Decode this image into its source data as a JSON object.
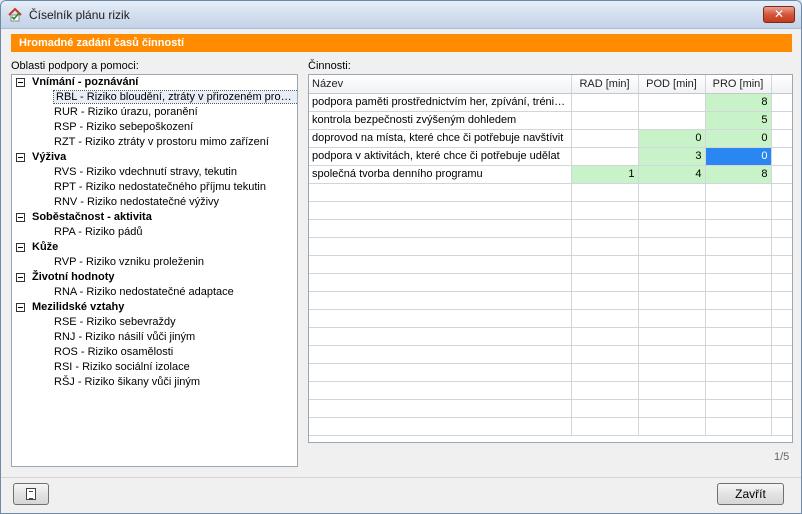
{
  "window": {
    "title": "Číselník plánu rizik",
    "close_glyph": "✕"
  },
  "banner": {
    "text": "Hromadné zadání časů činností"
  },
  "left_panel": {
    "label": "Oblasti podpory a pomoci:",
    "groups": [
      {
        "title": "Vnímání - poznávání",
        "items": [
          "RBL - Riziko bloudění, ztráty v přirozeném prostř...",
          "RUR - Riziko úrazu, poranění",
          "RSP - Riziko sebepoškození",
          "RZT - Riziko ztráty v prostoru mimo zařízení"
        ]
      },
      {
        "title": "Výživa",
        "items": [
          "RVS - Riziko vdechnutí stravy, tekutin",
          "RPT - Riziko nedostatečného příjmu tekutin",
          "RNV - Riziko nedostatečné výživy"
        ]
      },
      {
        "title": "Soběstačnost - aktivita",
        "items": [
          "RPA - Riziko pádů"
        ]
      },
      {
        "title": "Kůže",
        "items": [
          "RVP - Riziko vzniku proleženin"
        ]
      },
      {
        "title": "Životní hodnoty",
        "items": [
          "RNA - Riziko nedostatečné adaptace"
        ]
      },
      {
        "title": "Mezilidské vztahy",
        "items": [
          "RSE - Riziko sebevraždy",
          "RNJ - Riziko násilí vůči jiným",
          "ROS - Riziko osamělosti",
          "RSI - Riziko sociální izolace",
          "RŠJ - Riziko šikany vůči jiným"
        ]
      }
    ]
  },
  "right_panel": {
    "label": "Činnosti:",
    "columns": [
      "Název",
      "RAD [min]",
      "POD [min]",
      "PRO [min]"
    ],
    "rows": [
      {
        "name": "podpora paměti prostřednictvím her, zpívání, trénin...",
        "rad": "",
        "pod": "",
        "pro": "8",
        "rad_style": "",
        "pod_style": "",
        "pro_style": "green"
      },
      {
        "name": "kontrola bezpečnosti zvýšeným dohledem",
        "rad": "",
        "pod": "",
        "pro": "5",
        "rad_style": "",
        "pod_style": "",
        "pro_style": "green"
      },
      {
        "name": "doprovod na místa, které chce či potřebuje navštívit",
        "rad": "",
        "pod": "0",
        "pro": "0",
        "rad_style": "",
        "pod_style": "green",
        "pro_style": "green"
      },
      {
        "name": "podpora v aktivitách, které chce či potřebuje udělat",
        "rad": "",
        "pod": "3",
        "pro": "0",
        "rad_style": "",
        "pod_style": "green",
        "pro_style": "blue"
      },
      {
        "name": "společná tvorba denního programu",
        "rad": "1",
        "pod": "4",
        "pro": "8",
        "rad_style": "green",
        "pod_style": "green",
        "pro_style": "green"
      }
    ],
    "pager": "1/5"
  },
  "footer": {
    "close_label": "Zavřít"
  },
  "colors": {
    "banner": "#ff8c00",
    "cell_edit": "#c8f3c8",
    "cell_selected": "#2a86f0"
  }
}
